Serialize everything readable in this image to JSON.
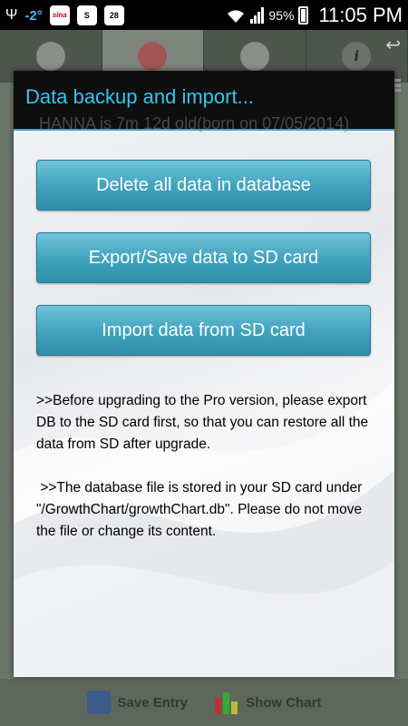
{
  "status_bar": {
    "temperature": "-2°",
    "battery_percent": "95%",
    "time": "11:05 PM",
    "icons": [
      "usb-icon",
      "weather-icon",
      "sina-icon",
      "shazam-icon",
      "calendar-icon",
      "wifi-icon",
      "signal-icon",
      "battery-icon"
    ],
    "calendar_day": "28",
    "sina_label": "sina"
  },
  "background_app": {
    "tabs": [
      "child-tab-icon",
      "baby-girl-tab-icon",
      "add-entry-tab-icon",
      "info-tab-icon"
    ],
    "header_text": "HANNA is 7m 12d old(born on 07/05/2014)",
    "bottom": {
      "save_label": "Save Entry",
      "chart_label": "Show Chart"
    },
    "colors": {
      "chart_red": "#d33",
      "chart_green": "#3a3",
      "chart_yellow": "#dc3"
    }
  },
  "dialog": {
    "title": "Data backup and import...",
    "buttons": {
      "delete": "Delete all data in database",
      "export": "Export/Save data to SD card",
      "import": "Import data from SD card"
    },
    "note1": ">>Before upgrading to the Pro version, please export DB to the SD card first, so that you can restore all the data from SD after upgrade.",
    "note2": " >>The database file is stored in your SD card under \"/GrowthChart/growthChart.db\". Please do not move the file or change its content.",
    "colors": {
      "title": "#33c6f0",
      "button": "#3fa2bd",
      "header_bg": "#0e0e0e"
    }
  }
}
